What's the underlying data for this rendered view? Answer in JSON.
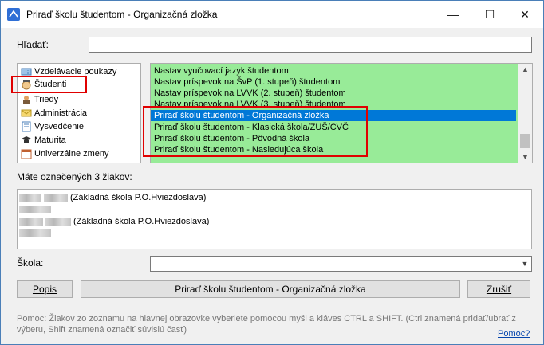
{
  "window": {
    "title": "Priraď školu študentom - Organizačná zložka",
    "controls": {
      "minimize": "—",
      "maximize": "☐",
      "close": "✕"
    },
    "accent": "#e00000"
  },
  "search": {
    "label": "Hľadať:",
    "value": ""
  },
  "categories": [
    {
      "label": "Vzdelávacie poukazy",
      "icon": "voucher-icon"
    },
    {
      "label": "Študenti",
      "icon": "student-icon"
    },
    {
      "label": "Triedy",
      "icon": "class-icon"
    },
    {
      "label": "Administrácia",
      "icon": "envelope-icon"
    },
    {
      "label": "Vysvedčenie",
      "icon": "certificate-icon"
    },
    {
      "label": "Maturita",
      "icon": "graduation-icon"
    },
    {
      "label": "Univerzálne zmeny",
      "icon": "calendar-icon"
    }
  ],
  "commands": [
    "Nastav vyučovací jazyk študentom",
    "Nastav príspevok na ŠvP (1. stupeň) študentom",
    "Nastav príspevok na LVVK (2. stupeň) študentom",
    "Nastav príspevok na LVVK (3. stupeň) študentom",
    "Priraď školu študentom - Organizačná zložka",
    "Priraď školu študentom - Klasická škola/ZUŠ/CVČ",
    "Priraď školu študentom - Pôvodná škola",
    "Priraď školu študentom - Nasledujúca škola"
  ],
  "selected_command": "Priraď školu študentom - Organizačná zložka",
  "marked": {
    "label": "Máte označených 3 žiakov:",
    "items": [
      "(Základná škola P.O.Hviezdoslava)",
      "(Základná škola P.O.Hviezdoslava)"
    ]
  },
  "school": {
    "label": "Škola:",
    "value": ""
  },
  "buttons": {
    "popis": "Popis",
    "main": "Priraď školu študentom - Organizačná zložka",
    "zrusit": "Zrušiť"
  },
  "help": {
    "text": "Pomoc: Žiakov zo zoznamu na hlavnej obrazovke vyberiete pomocou myši a kláves CTRL a SHIFT. (Ctrl znamená pridať/ubrať z výberu, Shift znamená označiť súvislú časť)",
    "link": "Pomoc?"
  }
}
